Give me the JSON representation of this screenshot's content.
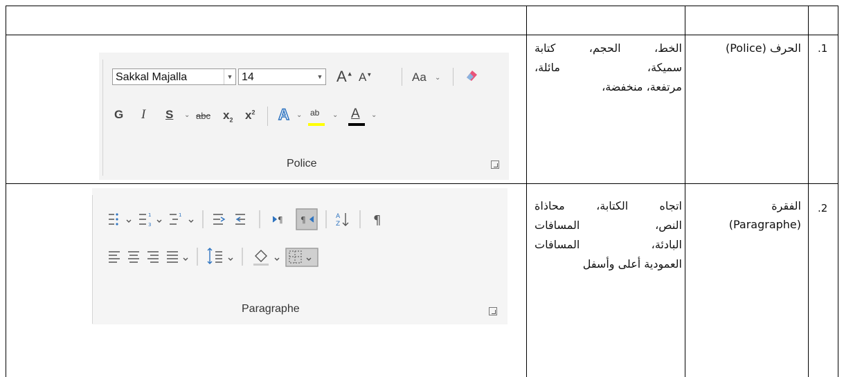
{
  "rows": [
    {
      "number": ".1",
      "name": "الحرف (Police)",
      "description_lines": [
        "الخط، الحجم، كتابة",
        "سميكة، مائلة،",
        "مرتفعة، منخفضة،"
      ],
      "ribbon": {
        "label": "Police",
        "font_name": "Sakkal Majalla",
        "font_size": "14",
        "grow_font": "A",
        "shrink_font": "A",
        "change_case": "Aa",
        "bold": "G",
        "italic": "I",
        "underline": "S",
        "strikethrough": "abc",
        "subscript": "x",
        "superscript": "x",
        "text_effects": "A",
        "highlight": "ab",
        "font_color": "A"
      }
    },
    {
      "number": ".2",
      "name_lines": [
        "الفقرة",
        "(Paragraphe)"
      ],
      "description_lines": [
        "اتجاه الكتابة، محاذاة",
        "النص، المسافات",
        "البادئة، المسافات",
        "العمودية أعلى وأسفل"
      ],
      "ribbon": {
        "label": "Paragraphe",
        "sort": "A Z",
        "pilcrow": "¶"
      }
    }
  ],
  "colors": {
    "highlight_yellow": "#ffff00",
    "font_color_bar": "#000000",
    "effects_blue": "#2f74c0",
    "eraser_pink": "#e8547a",
    "ribbon_bg": "#f3f3f3"
  }
}
